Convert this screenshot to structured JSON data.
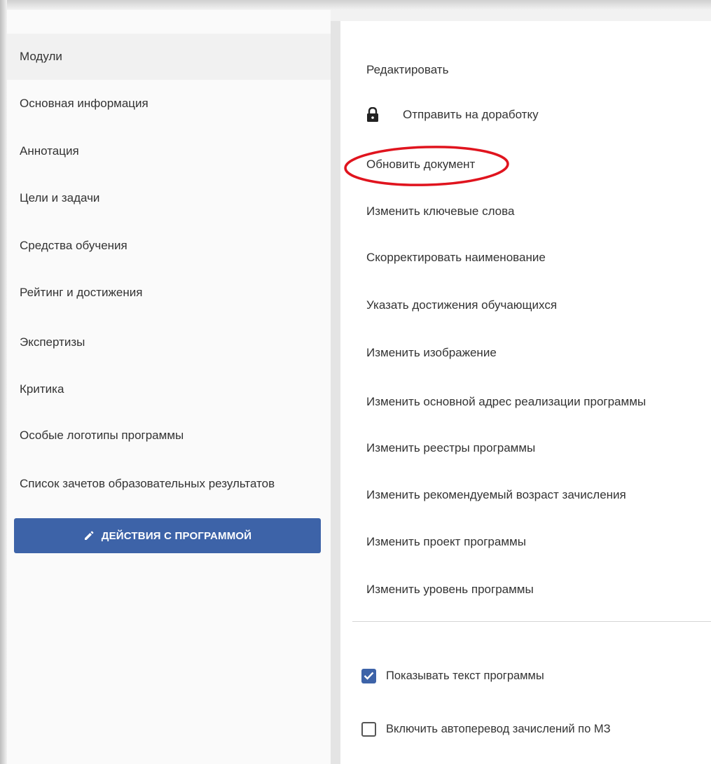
{
  "sidebar": {
    "items": [
      {
        "label": "Модули",
        "active": true
      },
      {
        "label": "Основная информация",
        "active": false
      },
      {
        "label": "Аннотация",
        "active": false
      },
      {
        "label": "Цели и задачи",
        "active": false
      },
      {
        "label": "Средства обучения",
        "active": false
      },
      {
        "label": "Рейтинг и достижения",
        "active": false
      },
      {
        "label": "Экспертизы",
        "active": false
      },
      {
        "label": "Критика",
        "active": false
      },
      {
        "label": "Особые логотипы программы",
        "active": false
      },
      {
        "label": "Список зачетов образовательных результатов",
        "active": false
      }
    ],
    "action_button": {
      "label": "ДЕЙСТВИЯ С ПРОГРАММОЙ",
      "icon": "pencil-icon"
    }
  },
  "actions_menu": {
    "items": [
      {
        "label": "Редактировать"
      },
      {
        "label": "Отправить на доработку",
        "icon": "lock-icon"
      },
      {
        "label": "Обновить документ",
        "highlighted": true
      },
      {
        "label": "Изменить ключевые слова"
      },
      {
        "label": "Скорректировать наименование"
      },
      {
        "label": "Указать достижения обучающихся"
      },
      {
        "label": "Изменить изображение"
      },
      {
        "label": "Изменить основной адрес реализации программы"
      },
      {
        "label": "Изменить реестры программы"
      },
      {
        "label": "Изменить рекомендуемый возраст зачисления"
      },
      {
        "label": "Изменить проект программы"
      },
      {
        "label": "Изменить уровень программы"
      }
    ],
    "options": [
      {
        "label": "Показывать текст программы",
        "checked": true
      },
      {
        "label": "Включить автоперевод зачислений по МЗ",
        "checked": false
      }
    ]
  },
  "colors": {
    "primary": "#3d63a8",
    "highlight_ellipse": "#e0141e",
    "text": "#333333"
  }
}
